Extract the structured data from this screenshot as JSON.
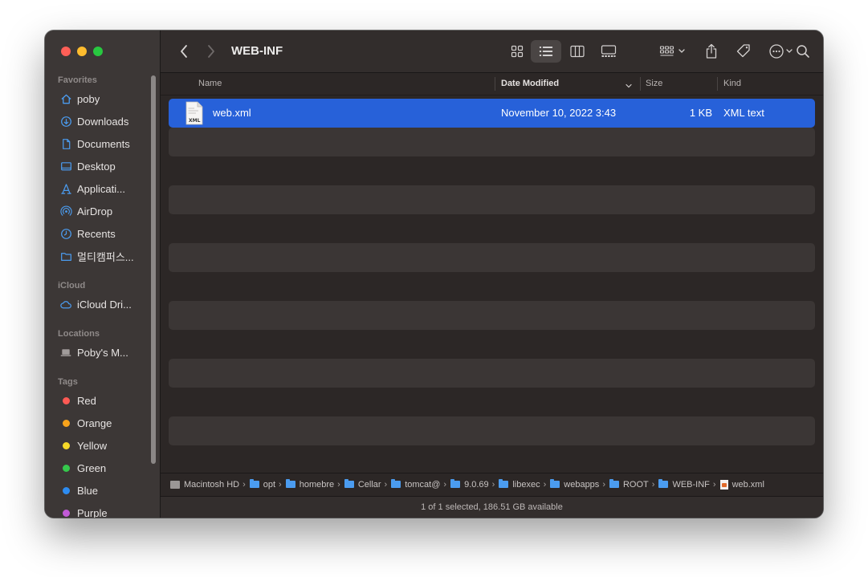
{
  "window": {
    "title": "WEB-INF"
  },
  "sidebar": {
    "favorites_header": "Favorites",
    "favorites": [
      {
        "label": "poby",
        "icon": "home-icon"
      },
      {
        "label": "Downloads",
        "icon": "download-icon"
      },
      {
        "label": "Documents",
        "icon": "document-icon"
      },
      {
        "label": "Desktop",
        "icon": "desktop-icon"
      },
      {
        "label": "Applicati...",
        "icon": "applications-icon"
      },
      {
        "label": "AirDrop",
        "icon": "airdrop-icon"
      },
      {
        "label": "Recents",
        "icon": "clock-icon"
      },
      {
        "label": "멀티캠퍼스...",
        "icon": "folder-icon"
      }
    ],
    "icloud_header": "iCloud",
    "icloud": [
      {
        "label": "iCloud Dri...",
        "icon": "cloud-icon"
      }
    ],
    "locations_header": "Locations",
    "locations": [
      {
        "label": "Poby's M...",
        "icon": "laptop-icon"
      }
    ],
    "tags_header": "Tags",
    "tags": [
      {
        "label": "Red",
        "color": "#fe5a54"
      },
      {
        "label": "Orange",
        "color": "#f8a31b"
      },
      {
        "label": "Yellow",
        "color": "#f6d928"
      },
      {
        "label": "Green",
        "color": "#35c84c"
      },
      {
        "label": "Blue",
        "color": "#2d8cf1"
      },
      {
        "label": "Purple",
        "color": "#c15ad7"
      }
    ]
  },
  "columns": {
    "name": "Name",
    "date_modified": "Date Modified",
    "size": "Size",
    "kind": "Kind"
  },
  "files": [
    {
      "name": "web.xml",
      "date_modified": "November 10, 2022 3:43",
      "size": "1 KB",
      "kind": "XML text",
      "icon_label": "XML",
      "selected": true
    }
  ],
  "path": [
    {
      "label": "Macintosh HD",
      "type": "disk"
    },
    {
      "label": "opt",
      "type": "folder"
    },
    {
      "label": "homebre",
      "type": "folder"
    },
    {
      "label": "Cellar",
      "type": "folder"
    },
    {
      "label": "tomcat@",
      "type": "folder"
    },
    {
      "label": "9.0.69",
      "type": "folder"
    },
    {
      "label": "libexec",
      "type": "folder"
    },
    {
      "label": "webapps",
      "type": "folder"
    },
    {
      "label": "ROOT",
      "type": "folder"
    },
    {
      "label": "WEB-INF",
      "type": "folder"
    },
    {
      "label": "web.xml",
      "type": "file"
    }
  ],
  "status": "1 of 1 selected, 186.51 GB available",
  "colors": {
    "selection": "#2761d9",
    "accent": "#4b9cf0"
  }
}
